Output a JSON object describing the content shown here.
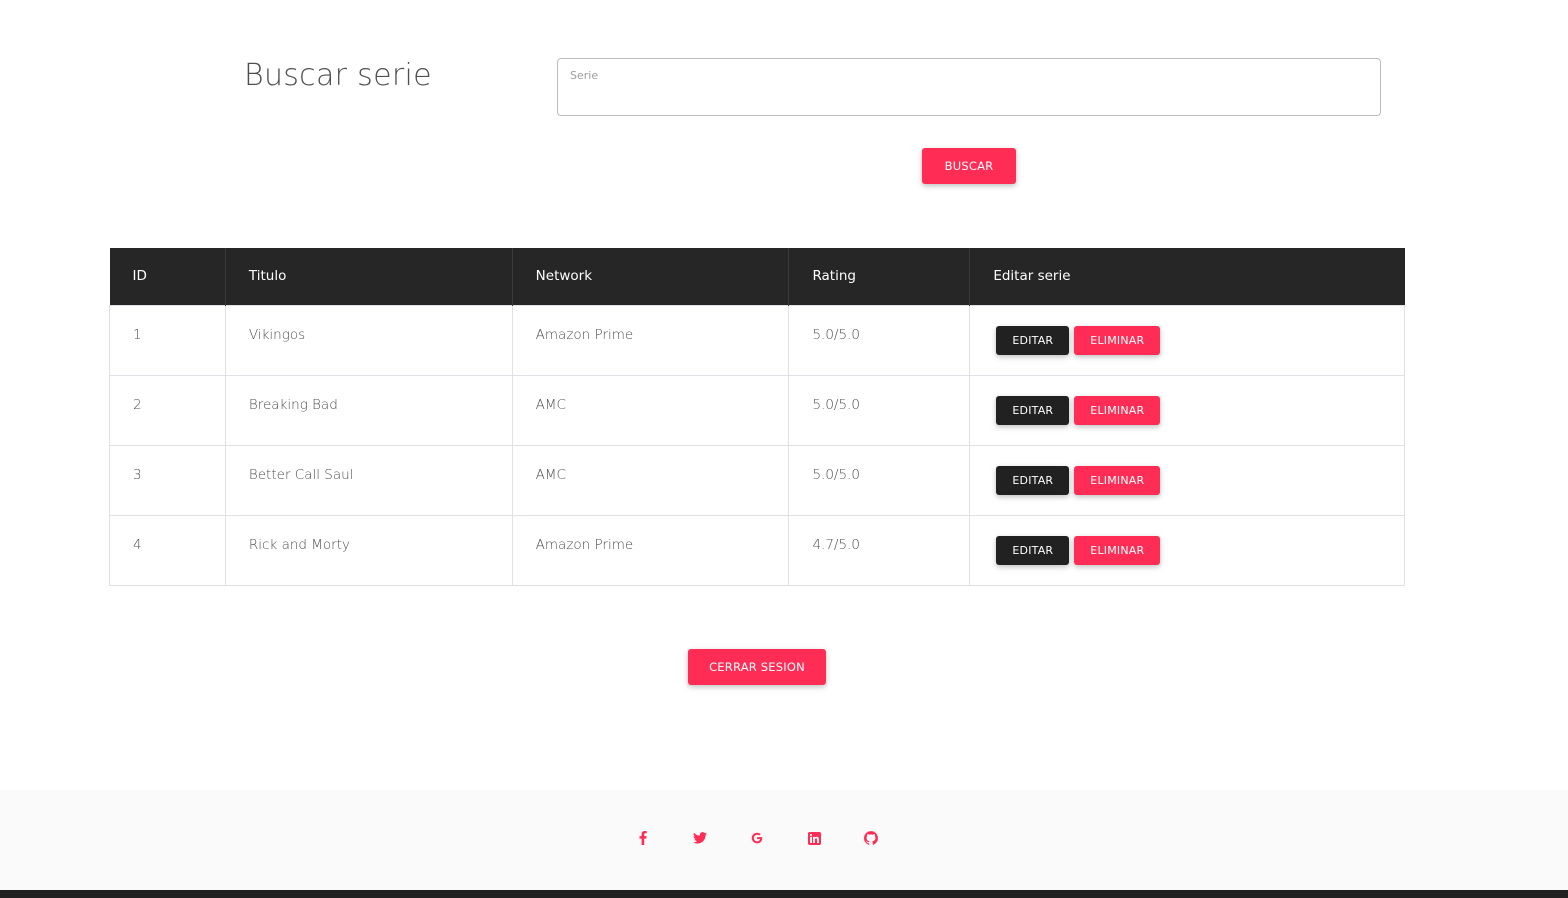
{
  "search": {
    "title": "Buscar serie",
    "placeholder": "Serie",
    "value": "",
    "button_label": "BUSCAR"
  },
  "table": {
    "headers": [
      "ID",
      "Titulo",
      "Network",
      "Rating",
      "Editar serie"
    ],
    "rows": [
      {
        "id": "1",
        "titulo": "Vikingos",
        "network": "Amazon Prime",
        "rating": "5.0/5.0"
      },
      {
        "id": "2",
        "titulo": "Breaking Bad",
        "network": "AMC",
        "rating": "5.0/5.0"
      },
      {
        "id": "3",
        "titulo": "Better Call Saul",
        "network": "AMC",
        "rating": "5.0/5.0"
      },
      {
        "id": "4",
        "titulo": "Rick and Morty",
        "network": "Amazon Prime",
        "rating": "4.7/5.0"
      }
    ],
    "edit_label": "EDITAR",
    "delete_label": "ELIMINAR"
  },
  "logout": {
    "label": "CERRAR SESION"
  },
  "footer": {
    "social_icons": [
      "facebook-icon",
      "twitter-icon",
      "google-icon",
      "linkedin-icon",
      "github-icon"
    ]
  },
  "colors": {
    "accent": "#ff2d55",
    "dark": "#212121",
    "table_header": "#262626",
    "footer_bg": "#fafafa"
  }
}
